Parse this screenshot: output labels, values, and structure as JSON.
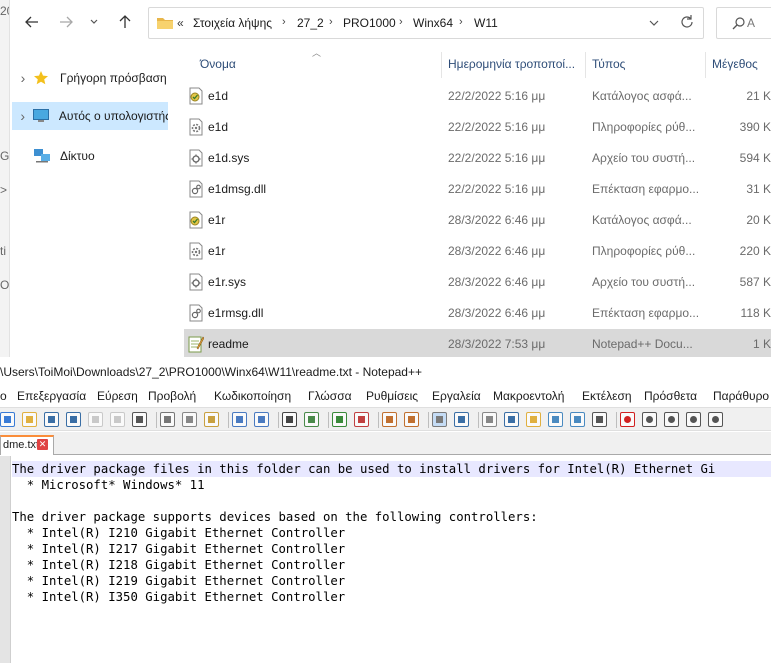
{
  "explorer": {
    "bg_strip_chars": [
      "20",
      "G",
      ">",
      "ti",
      "Ο"
    ],
    "address": {
      "overflow": "«",
      "crumbs": [
        "Στοιχεία λήψης",
        "27_2",
        "PRO1000",
        "Winx64",
        "W11"
      ]
    },
    "search_placeholder": "Α",
    "nav": [
      {
        "label": "Γρήγορη πρόσβαση",
        "icon": "star-icon",
        "selected": false
      },
      {
        "label": "Αυτός ο υπολογιστής",
        "icon": "computer-icon",
        "selected": true
      },
      {
        "label": "Δίκτυο",
        "icon": "network-icon",
        "selected": false
      }
    ],
    "columns": {
      "name": "Όνομα",
      "date": "Ημερομηνία τροποποί...",
      "type": "Τύπος",
      "size": "Μέγεθος"
    },
    "files": [
      {
        "name": "e1d",
        "date": "22/2/2022 5:16 μμ",
        "type": "Κατάλογος ασφά...",
        "size": "21 K",
        "icon": "security-catalog-icon"
      },
      {
        "name": "e1d",
        "date": "22/2/2022 5:16 μμ",
        "type": "Πληροφορίες ρύθ...",
        "size": "390 K",
        "icon": "setup-info-icon"
      },
      {
        "name": "e1d.sys",
        "date": "22/2/2022 5:16 μμ",
        "type": "Αρχείο του συστή...",
        "size": "594 K",
        "icon": "system-file-icon"
      },
      {
        "name": "e1dmsg.dll",
        "date": "22/2/2022 5:16 μμ",
        "type": "Επέκταση εφαρμο...",
        "size": "31 K",
        "icon": "dll-file-icon"
      },
      {
        "name": "e1r",
        "date": "28/3/2022 6:46 μμ",
        "type": "Κατάλογος ασφά...",
        "size": "20 K",
        "icon": "security-catalog-icon"
      },
      {
        "name": "e1r",
        "date": "28/3/2022 6:46 μμ",
        "type": "Πληροφορίες ρύθ...",
        "size": "220 K",
        "icon": "setup-info-icon"
      },
      {
        "name": "e1r.sys",
        "date": "28/3/2022 6:46 μμ",
        "type": "Αρχείο του συστή...",
        "size": "587 K",
        "icon": "system-file-icon"
      },
      {
        "name": "e1rmsg.dll",
        "date": "28/3/2022 6:46 μμ",
        "type": "Επέκταση εφαρμο...",
        "size": "118 K",
        "icon": "dll-file-icon"
      },
      {
        "name": "readme",
        "date": "28/3/2022 7:53 μμ",
        "type": "Notepad++ Docu...",
        "size": "1 K",
        "icon": "notepadpp-document-icon",
        "selected": true
      }
    ]
  },
  "notepad": {
    "title": "\\Users\\ToiMoi\\Downloads\\27_2\\PRO1000\\Winx64\\W11\\readme.txt - Notepad++",
    "menu": [
      "ο",
      "Επεξεργασία",
      "Εύρεση",
      "Προβολή",
      "Κωδικοποίηση",
      "Γλώσσα",
      "Ρυθμίσεις",
      "Εργαλεία",
      "Μακροεντολή",
      "Εκτέλεση",
      "Πρόσθετα",
      "Παράθυρο"
    ],
    "tab_label": "dme.txt",
    "tab_close": "✕",
    "lines": [
      "The driver package files in this folder can be used to install drivers for Intel(R) Ethernet Gi",
      "  * Microsoft* Windows* 11",
      "",
      "The driver package supports devices based on the following controllers:",
      "  * Intel(R) I210 Gigabit Ethernet Controller",
      "  * Intel(R) I217 Gigabit Ethernet Controller",
      "  * Intel(R) I218 Gigabit Ethernet Controller",
      "  * Intel(R) I219 Gigabit Ethernet Controller",
      "  * Intel(R) I350 Gigabit Ethernet Controller"
    ],
    "toolbar_icons": [
      "new-file-icon",
      "open-file-icon",
      "save-icon",
      "save-all-icon",
      "close-icon",
      "close-all-icon",
      "print-icon",
      "cut-icon",
      "copy-icon",
      "paste-icon",
      "undo-icon",
      "redo-icon",
      "find-icon",
      "replace-icon",
      "zoom-in-icon",
      "zoom-out-icon",
      "sync-vertical-icon",
      "sync-horizontal-icon",
      "word-wrap-icon",
      "show-all-chars-icon",
      "indent-guide-icon",
      "function-list-icon",
      "folder-as-workspace-icon",
      "doc-map-icon",
      "doc-list-icon",
      "monitoring-icon",
      "record-macro-icon",
      "stop-macro-icon",
      "play-macro-icon",
      "run-macro-multiple-icon",
      "save-macro-icon"
    ]
  }
}
